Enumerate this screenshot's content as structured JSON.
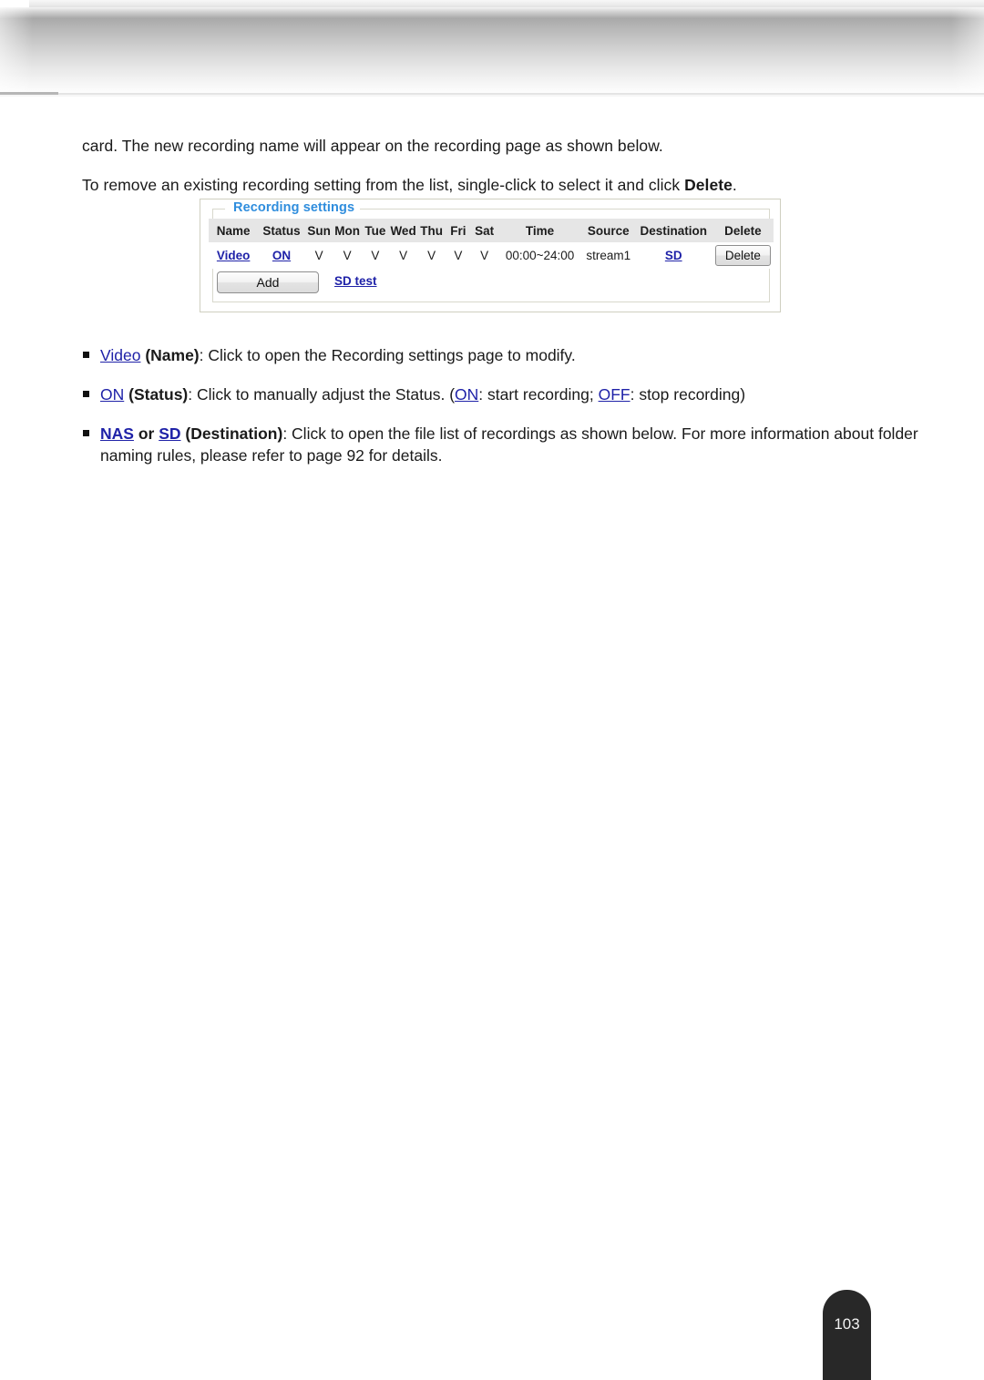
{
  "document": {
    "page_number": "103"
  },
  "paragraphs": {
    "p1": "card. The new recording name will appear on the recording page as shown below.",
    "p2_before": "To remove an existing recording setting from the list, single-click to select it and click ",
    "p2_bold": "Delete",
    "p2_after": "."
  },
  "panel": {
    "legend": "Recording settings",
    "add_button": "Add",
    "sd_test_link": "SD test",
    "table": {
      "headers": [
        "Name",
        "Status",
        "Sun",
        "Mon",
        "Tue",
        "Wed",
        "Thu",
        "Fri",
        "Sat",
        "Time",
        "Source",
        "Destination",
        "Delete"
      ],
      "rows": [
        {
          "name": "Video",
          "status": "ON",
          "sun": "V",
          "mon": "V",
          "tue": "V",
          "wed": "V",
          "thu": "V",
          "fri": "V",
          "sat": "V",
          "time": "00:00~24:00",
          "source": "stream1",
          "destination": "SD",
          "delete_button": "Delete"
        }
      ]
    }
  },
  "bullets": [
    {
      "link": "Video",
      "bold1": " (Name)",
      "rest": ": Click to open the Recording settings page to modify."
    },
    {
      "link": "ON",
      "bold1": " (Status)",
      "rest_a": ": Click to manually adjust the Status. (",
      "link2": "ON",
      "rest_b": ": start recording; ",
      "link3": "OFF",
      "rest_c": ": stop recording)"
    },
    {
      "link": "NAS",
      "mid": " or ",
      "link2": "SD",
      "bold1": " (Destination)",
      "rest": ": Click to open the file list of recordings as shown below. For more information about folder naming rules, please refer to page 92 for details."
    }
  ],
  "colors": {
    "link": "#1f22a8",
    "legend": "#2f8ddd",
    "table_header_bg": "#e6e6e6",
    "page_tab_bg": "#282828"
  }
}
